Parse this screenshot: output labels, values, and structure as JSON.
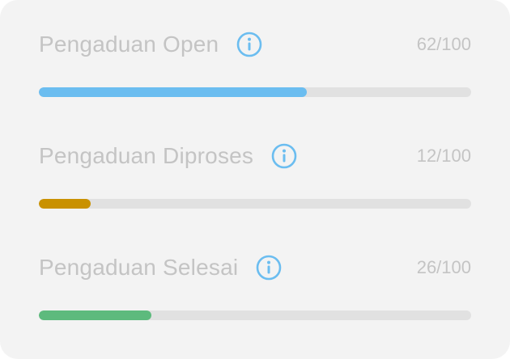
{
  "colors": {
    "info_icon": "#6bbdf0",
    "track": "#e1e1e1",
    "label": "#c4c4c4"
  },
  "stats": [
    {
      "label": "Pengaduan Open",
      "count_text": "62/100",
      "value": 62,
      "max": 100,
      "color": "#6bbdf0",
      "icon": "info-icon"
    },
    {
      "label": "Pengaduan Diproses",
      "count_text": "12/100",
      "value": 12,
      "max": 100,
      "color": "#c99100",
      "icon": "info-icon"
    },
    {
      "label": "Pengaduan Selesai",
      "count_text": "26/100",
      "value": 26,
      "max": 100,
      "color": "#5dba7d",
      "icon": "info-icon"
    }
  ]
}
